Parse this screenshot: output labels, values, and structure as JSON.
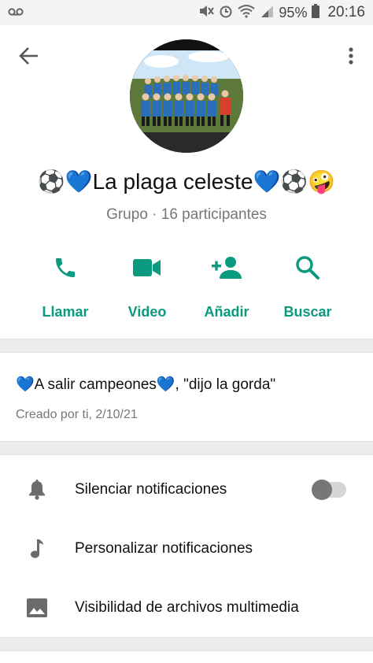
{
  "status_bar": {
    "battery": "95%",
    "time": "20:16"
  },
  "header": {
    "group_name": "⚽💙La plaga celeste💙⚽🤪",
    "subtitle": "Grupo · 16 participantes"
  },
  "actions": [
    {
      "label": "Llamar",
      "icon": "phone-icon"
    },
    {
      "label": "Video",
      "icon": "video-icon"
    },
    {
      "label": "Añadir",
      "icon": "add-person-icon"
    },
    {
      "label": "Buscar",
      "icon": "search-icon"
    }
  ],
  "description": {
    "text": "💙A salir campeones💙, \"dijo la gorda\"",
    "created": "Creado por ti, 2/10/21"
  },
  "settings": [
    {
      "label": "Silenciar notificaciones",
      "icon": "bell-icon",
      "toggle": false
    },
    {
      "label": "Personalizar notificaciones",
      "icon": "music-note-icon"
    },
    {
      "label": "Visibilidad de archivos multimedia",
      "icon": "image-icon"
    }
  ],
  "colors": {
    "accent": "#0a9a7f",
    "icon_grey": "#6b6b6b"
  }
}
